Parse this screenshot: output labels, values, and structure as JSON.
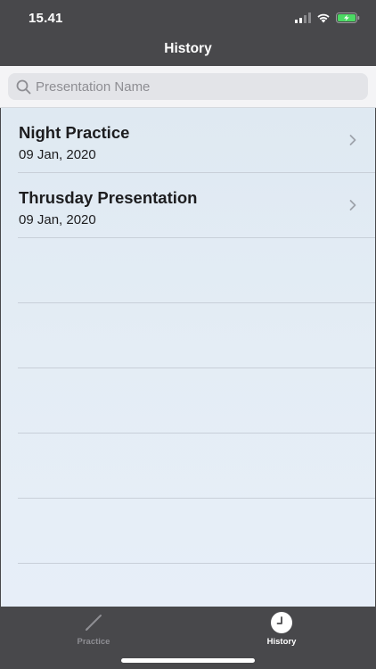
{
  "status_bar": {
    "time": "15.41"
  },
  "nav": {
    "title": "History"
  },
  "search": {
    "placeholder": "Presentation Name",
    "value": ""
  },
  "history": {
    "items": [
      {
        "name": "Night Practice",
        "date": "09 Jan, 2020"
      },
      {
        "name": "Thrusday Presentation",
        "date": "09 Jan, 2020"
      }
    ]
  },
  "tab_bar": {
    "tabs": [
      {
        "label": "Practice",
        "icon": "pencil-icon",
        "selected": false
      },
      {
        "label": "History",
        "icon": "clock-icon",
        "selected": true
      }
    ]
  },
  "colors": {
    "chrome": "#48484b",
    "list_background": "#e2ebf4",
    "battery_fill": "#4cd964",
    "inactive_tab": "#8e8e93",
    "active_tab": "#ffffff"
  }
}
